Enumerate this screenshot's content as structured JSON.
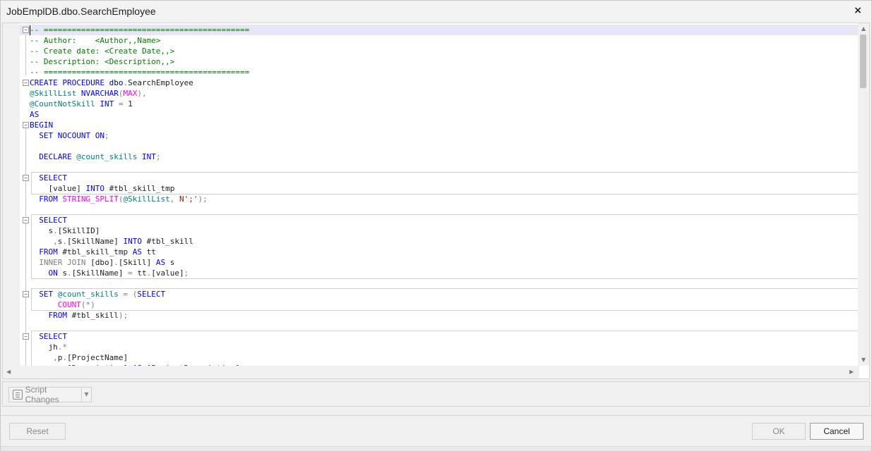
{
  "window": {
    "title": "JobEmplDB.dbo.SearchEmployee",
    "close_label": "×"
  },
  "editor": {
    "lines": [
      [
        {
          "t": "-- ============================================",
          "c": "green"
        }
      ],
      [
        {
          "t": "-- Author:    <Author,,Name>",
          "c": "green"
        }
      ],
      [
        {
          "t": "-- Create date: <Create Date,,>",
          "c": "green"
        }
      ],
      [
        {
          "t": "-- Description: <Description,,>",
          "c": "green"
        }
      ],
      [
        {
          "t": "-- ============================================",
          "c": "green"
        }
      ],
      [
        {
          "t": "CREATE PROCEDURE ",
          "c": "blue"
        },
        {
          "t": "dbo",
          "c": "darkblue"
        },
        {
          "t": ".",
          "c": "gray"
        },
        {
          "t": "SearchEmployee",
          "c": "black"
        }
      ],
      [
        {
          "t": "@SkillList",
          "c": "teal"
        },
        {
          "t": " NVARCHAR",
          "c": "blue"
        },
        {
          "t": "(",
          "c": "gray"
        },
        {
          "t": "MAX",
          "c": "pink"
        },
        {
          "t": "),",
          "c": "gray"
        }
      ],
      [
        {
          "t": "@CountNotSkill",
          "c": "teal"
        },
        {
          "t": " INT ",
          "c": "blue"
        },
        {
          "t": "= ",
          "c": "gray"
        },
        {
          "t": "1",
          "c": "black"
        }
      ],
      [
        {
          "t": "AS",
          "c": "blue"
        }
      ],
      [
        {
          "t": "BEGIN",
          "c": "blue"
        }
      ],
      [
        {
          "t": "  SET NOCOUNT ON",
          "c": "blue"
        },
        {
          "t": ";",
          "c": "gray"
        }
      ],
      [
        {
          "t": "",
          "c": "black"
        }
      ],
      [
        {
          "t": "  DECLARE ",
          "c": "blue"
        },
        {
          "t": "@count_skills",
          "c": "teal"
        },
        {
          "t": " INT",
          "c": "blue"
        },
        {
          "t": ";",
          "c": "gray"
        }
      ],
      [
        {
          "t": "",
          "c": "black"
        }
      ],
      [
        {
          "t": "  SELECT",
          "c": "blue"
        }
      ],
      [
        {
          "t": "    [value] ",
          "c": "black"
        },
        {
          "t": "INTO ",
          "c": "blue"
        },
        {
          "t": "#tbl_skill_tmp",
          "c": "black"
        }
      ],
      [
        {
          "t": "  FROM ",
          "c": "blue"
        },
        {
          "t": "STRING_SPLIT",
          "c": "pink"
        },
        {
          "t": "(",
          "c": "gray"
        },
        {
          "t": "@SkillList",
          "c": "teal"
        },
        {
          "t": ", ",
          "c": "gray"
        },
        {
          "t": "N';'",
          "c": "red"
        },
        {
          "t": ");",
          "c": "gray"
        }
      ],
      [
        {
          "t": "",
          "c": "black"
        }
      ],
      [
        {
          "t": "  SELECT",
          "c": "blue"
        }
      ],
      [
        {
          "t": "    s",
          "c": "black"
        },
        {
          "t": ".",
          "c": "gray"
        },
        {
          "t": "[SkillID]",
          "c": "black"
        }
      ],
      [
        {
          "t": "     ,",
          "c": "gray"
        },
        {
          "t": "s",
          "c": "black"
        },
        {
          "t": ".",
          "c": "gray"
        },
        {
          "t": "[SkillName] ",
          "c": "black"
        },
        {
          "t": "INTO ",
          "c": "blue"
        },
        {
          "t": "#tbl_skill",
          "c": "black"
        }
      ],
      [
        {
          "t": "  FROM ",
          "c": "blue"
        },
        {
          "t": "#tbl_skill_tmp ",
          "c": "black"
        },
        {
          "t": "AS ",
          "c": "blue"
        },
        {
          "t": "tt",
          "c": "black"
        }
      ],
      [
        {
          "t": "  INNER JOIN ",
          "c": "gray"
        },
        {
          "t": "[dbo]",
          "c": "black"
        },
        {
          "t": ".",
          "c": "gray"
        },
        {
          "t": "[Skill] ",
          "c": "black"
        },
        {
          "t": "AS ",
          "c": "blue"
        },
        {
          "t": "s",
          "c": "black"
        }
      ],
      [
        {
          "t": "    ON ",
          "c": "blue"
        },
        {
          "t": "s",
          "c": "black"
        },
        {
          "t": ".",
          "c": "gray"
        },
        {
          "t": "[SkillName] ",
          "c": "black"
        },
        {
          "t": "= ",
          "c": "gray"
        },
        {
          "t": "tt",
          "c": "black"
        },
        {
          "t": ".",
          "c": "gray"
        },
        {
          "t": "[value]",
          "c": "black"
        },
        {
          "t": ";",
          "c": "gray"
        }
      ],
      [
        {
          "t": "",
          "c": "black"
        }
      ],
      [
        {
          "t": "  SET ",
          "c": "blue"
        },
        {
          "t": "@count_skills",
          "c": "teal"
        },
        {
          "t": " = ",
          "c": "gray"
        },
        {
          "t": "(",
          "c": "gray"
        },
        {
          "t": "SELECT",
          "c": "blue"
        }
      ],
      [
        {
          "t": "      COUNT",
          "c": "pink"
        },
        {
          "t": "(*)",
          "c": "gray"
        }
      ],
      [
        {
          "t": "    FROM ",
          "c": "blue"
        },
        {
          "t": "#tbl_skill",
          "c": "black"
        },
        {
          "t": ");",
          "c": "gray"
        }
      ],
      [
        {
          "t": "",
          "c": "black"
        }
      ],
      [
        {
          "t": "  SELECT",
          "c": "blue"
        }
      ],
      [
        {
          "t": "    jh",
          "c": "black"
        },
        {
          "t": ".*",
          "c": "gray"
        }
      ],
      [
        {
          "t": "     ,",
          "c": "gray"
        },
        {
          "t": "p",
          "c": "black"
        },
        {
          "t": ".",
          "c": "gray"
        },
        {
          "t": "[ProjectName]",
          "c": "black"
        }
      ],
      [
        {
          "t": "     ,",
          "c": "gray"
        },
        {
          "t": "p",
          "c": "black"
        },
        {
          "t": ".",
          "c": "gray"
        },
        {
          "t": "[Description] ",
          "c": "black"
        },
        {
          "t": "AS ",
          "c": "blue"
        },
        {
          "t": "[ProjectDescription]",
          "c": "black"
        }
      ]
    ]
  },
  "toolbar": {
    "script_changes_label": "Script Changes"
  },
  "footer": {
    "reset_label": "Reset",
    "ok_label": "OK",
    "cancel_label": "Cancel"
  },
  "icons": {
    "close": "close-icon",
    "script": "script-icon",
    "dropdown": "chevron-down-icon"
  },
  "colors": {
    "keyword": "#0000ff",
    "comment": "#008000",
    "variable": "#008080",
    "function": "#ff00ff",
    "string": "#a31515",
    "operator": "#808080"
  }
}
